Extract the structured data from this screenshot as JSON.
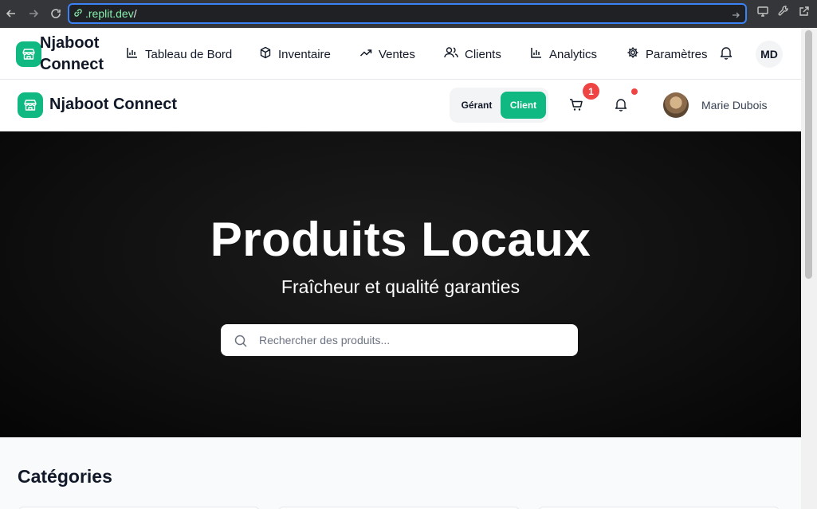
{
  "browser": {
    "url_host": ".replit.dev",
    "url_path": "/",
    "icons": [
      "back-icon",
      "forward-icon",
      "reload-icon",
      "link-icon",
      "screen-icon",
      "wrench-icon",
      "open-external-icon"
    ]
  },
  "topnav": {
    "brand": "Njaboot Connect",
    "items": [
      {
        "label": "Tableau de Bord",
        "icon": "bar-chart-icon"
      },
      {
        "label": "Inventaire",
        "icon": "box-icon"
      },
      {
        "label": "Ventes",
        "icon": "trending-up-icon"
      },
      {
        "label": "Clients",
        "icon": "users-icon"
      },
      {
        "label": "Analytics",
        "icon": "bar-chart-icon"
      },
      {
        "label": "Paramètres",
        "icon": "gear-icon"
      }
    ],
    "avatar_initials": "MD"
  },
  "subheader": {
    "brand": "Njaboot Connect",
    "role_gerant": "Gérant",
    "role_client": "Client",
    "cart_count": "1",
    "user_name": "Marie Dubois"
  },
  "hero": {
    "title": "Produits Locaux",
    "subtitle": "Fraîcheur et qualité garanties",
    "search_placeholder": "Rechercher des produits..."
  },
  "categories": {
    "title": "Catégories"
  },
  "colors": {
    "accent": "#10b981",
    "badge": "#ef4444",
    "url_focus": "#3b82f6"
  }
}
